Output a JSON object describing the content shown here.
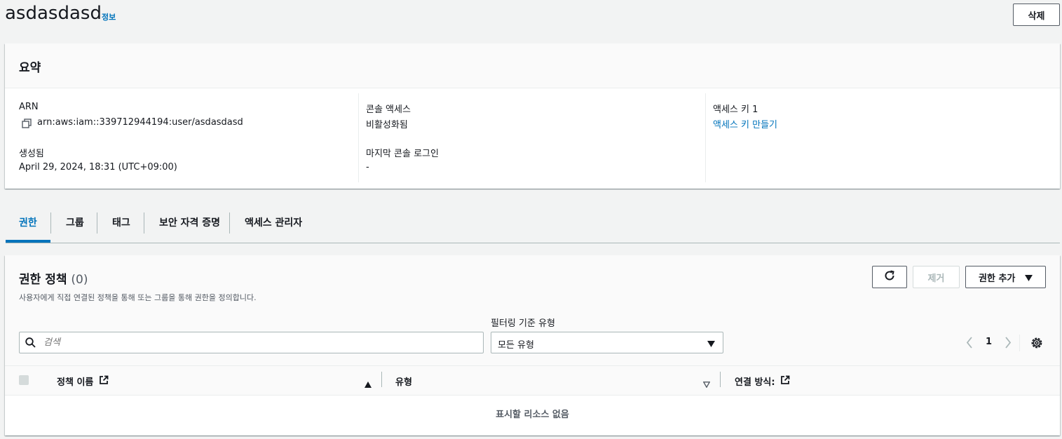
{
  "header": {
    "title": "asdasdasd",
    "info_link": "정보",
    "delete_label": "삭제"
  },
  "summary": {
    "title": "요약",
    "arn_label": "ARN",
    "arn_value": "arn:aws:iam::339712944194:user/asdasdasd",
    "created_label": "생성됨",
    "created_value": "April 29, 2024, 18:31 (UTC+09:00)",
    "console_access_label": "콘솔 액세스",
    "console_access_value": "비활성화됨",
    "last_login_label": "마지막 콘솔 로그인",
    "last_login_value": "-",
    "access_key_label": "액세스 키 1",
    "access_key_link": "액세스 키 만들기"
  },
  "tabs": [
    "권한",
    "그룹",
    "태그",
    "보안 자격 증명",
    "액세스 관리자"
  ],
  "permissions": {
    "title": "권한 정책",
    "count": "(0)",
    "description": "사용자에게 직접 연결된 정책을 통해 또는 그룹을 통해 권한을 정의합니다.",
    "remove_label": "제거",
    "add_label": "권한 추가",
    "search_placeholder": "검색",
    "filter_label": "필터링 기준 유형",
    "filter_value": "모든 유형",
    "page": "1",
    "columns": {
      "policy_name": "정책 이름",
      "type": "유형",
      "attached_via": "연결 방식:"
    },
    "empty_message": "표시할 리소스 없음"
  },
  "colors": {
    "accent": "#0073bb",
    "text": "#16191f",
    "background": "#f2f3f3"
  }
}
